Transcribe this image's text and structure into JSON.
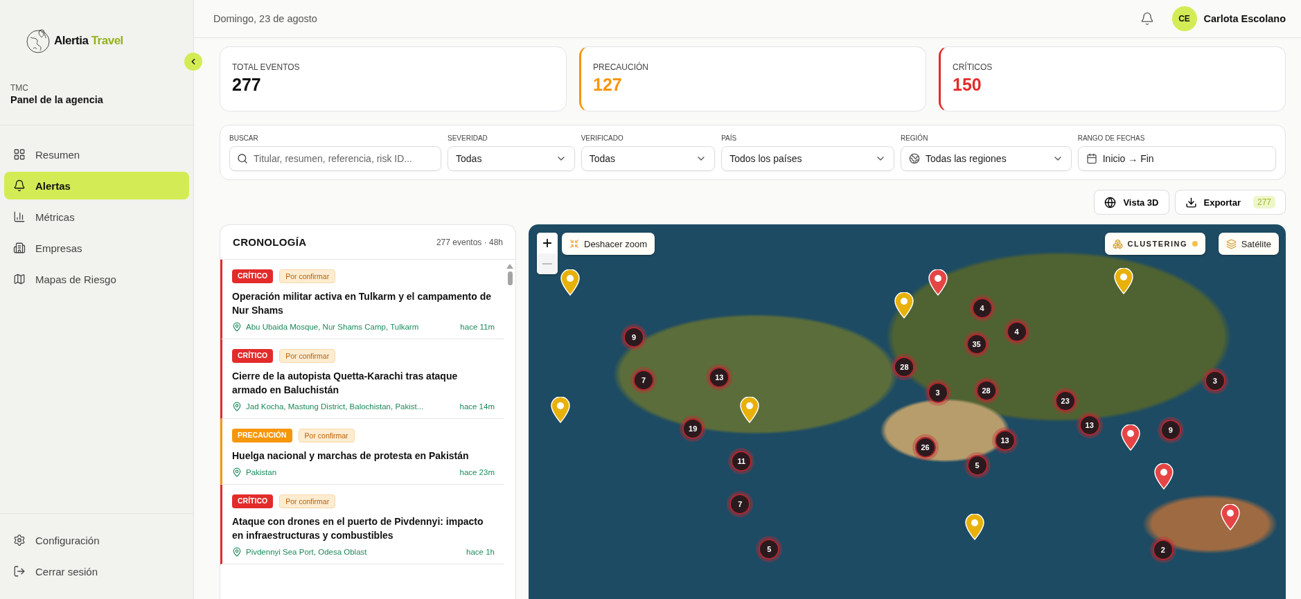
{
  "sidebar": {
    "brand": {
      "name": "Alertia",
      "accent": "Travel"
    },
    "org_type": "TMC",
    "org_title": "Panel de la agencia",
    "items": [
      {
        "label": "Resumen",
        "selected": false
      },
      {
        "label": "Alertas",
        "selected": true
      },
      {
        "label": "Métricas",
        "selected": false
      },
      {
        "label": "Empresas",
        "selected": false
      },
      {
        "label": "Mapas de Riesgo",
        "selected": false
      }
    ],
    "footer_items": [
      {
        "label": "Configuración"
      },
      {
        "label": "Cerrar sesión"
      }
    ]
  },
  "header": {
    "date": "Domingo, 23 de agosto",
    "user": {
      "initials": "CE",
      "name": "Carlota Escolano"
    }
  },
  "stats": [
    {
      "label": "TOTAL EVENTOS",
      "value": "277",
      "kind": "total"
    },
    {
      "label": "PRECAUCIÓN",
      "value": "127",
      "kind": "caution"
    },
    {
      "label": "CRÍTICOS",
      "value": "150",
      "kind": "critical"
    }
  ],
  "filters": [
    {
      "label": "BUSCAR",
      "kind": "search",
      "placeholder": "Titular, resumen, referencia, risk ID..."
    },
    {
      "label": "SEVERIDAD",
      "kind": "select",
      "value": "Todas"
    },
    {
      "label": "VERIFICADO",
      "kind": "select",
      "value": "Todas"
    },
    {
      "label": "PAÍS",
      "kind": "select",
      "value": "Todos los países"
    },
    {
      "label": "REGIÓN",
      "kind": "region",
      "value": "Todas las regiones"
    },
    {
      "label": "RANGO DE FECHAS",
      "kind": "date",
      "value": "Inicio → Fin"
    }
  ],
  "actions": {
    "view3d": "Vista 3D",
    "export": "Exportar",
    "export_count": "277"
  },
  "timeline": {
    "title": "CRONOLOGÍA",
    "summary": "277 eventos · 48h",
    "items": [
      {
        "kind": "critical",
        "badge": "CRÍTICO",
        "status": "Por confirmar",
        "title": "Operación militar activa en Tulkarm y el campamento de Nur Shams",
        "location": "Abu Ubaida Mosque, Nur Shams Camp, Tulkarm",
        "time": "hace 11m"
      },
      {
        "kind": "critical",
        "badge": "CRÍTICO",
        "status": "Por confirmar",
        "title": "Cierre de la autopista Quetta-Karachi tras ataque armado en Baluchistán",
        "location": "Jad Kocha, Mastung District, Balochistan, Pakist...",
        "time": "hace 14m"
      },
      {
        "kind": "caution",
        "badge": "PRECAUCIÓN",
        "status": "Por confirmar",
        "title": "Huelga nacional y marchas de protesta en Pakistán",
        "location": "Pakistan",
        "time": "hace 23m"
      },
      {
        "kind": "critical",
        "badge": "CRÍTICO",
        "status": "Por confirmar",
        "title": "Ataque con drones en el puerto de Pivdennyi: impacto en infraestructuras y combustibles",
        "location": "Pivdennyi Sea Port, Odesa Oblast",
        "time": "hace 1h"
      }
    ]
  },
  "map": {
    "undo_zoom": "Deshacer zoom",
    "zoom_out_disabled": true,
    "clustering": {
      "label": "CLUSTERING",
      "on": true
    },
    "layer": "Satélite",
    "clusters": [
      {
        "count": "9"
      },
      {
        "count": "7"
      },
      {
        "count": "13"
      },
      {
        "count": "19"
      },
      {
        "count": "11"
      },
      {
        "count": "7"
      },
      {
        "count": "5"
      },
      {
        "count": "4"
      },
      {
        "count": "4"
      },
      {
        "count": "35"
      },
      {
        "count": "28"
      },
      {
        "count": "3"
      },
      {
        "count": "28"
      },
      {
        "count": "23"
      },
      {
        "count": "13"
      },
      {
        "count": "3"
      },
      {
        "count": "9"
      },
      {
        "count": "26"
      },
      {
        "count": "13"
      },
      {
        "count": "5"
      },
      {
        "count": "2"
      }
    ],
    "pins": [
      {
        "color": "#e8b10a"
      },
      {
        "color": "#e8b10a"
      },
      {
        "color": "#e64545"
      },
      {
        "color": "#e8b10a"
      },
      {
        "color": "#e8b10a"
      },
      {
        "color": "#e8b10a"
      },
      {
        "color": "#e8b10a"
      },
      {
        "color": "#e64545"
      },
      {
        "color": "#e64545"
      },
      {
        "color": "#e64545"
      }
    ]
  }
}
